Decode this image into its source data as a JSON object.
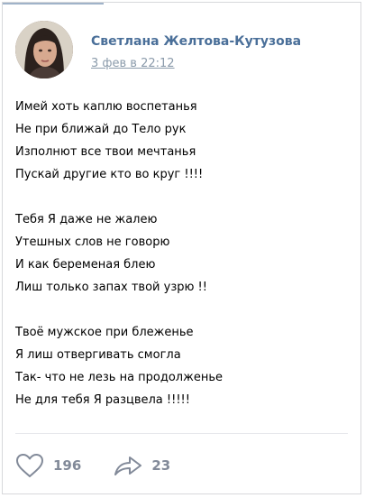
{
  "post": {
    "author": "Светлана Желтова-Кутузова",
    "date": "3 фев в 22:12",
    "stanzas": [
      [
        "Имей хоть каплю воспетанья",
        "Не при ближай до Тело рук",
        "Изполнют все твои мечтанья",
        "Пускай другие кто во круг !!!!"
      ],
      [
        "Тебя Я даже не жалею",
        "Утешных слов не говорю",
        "И как беременая блею",
        "Лиш только запах твой узрю !!"
      ],
      [
        "Твоё мужское при блеженье",
        "Я лиш отвергивать смогла",
        "Так- что не лезь на продолженье",
        "Не для тебя Я разцвела !!!!!"
      ]
    ]
  },
  "actions": {
    "like_count": "196",
    "share_count": "23",
    "like_icon": "heart-outline",
    "share_icon": "share-arrow"
  },
  "colors": {
    "author_link": "#4a6f99",
    "date_link": "#8b9bab",
    "action_icon": "#828a99"
  }
}
